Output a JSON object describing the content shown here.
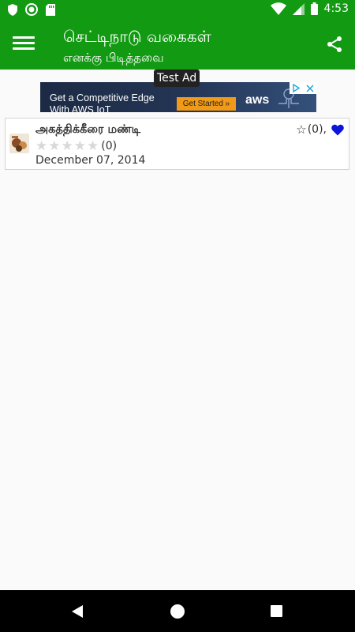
{
  "status_bar": {
    "time": "4:53",
    "icons": [
      "shield-icon",
      "circle-icon",
      "sd-card-icon",
      "wifi-icon",
      "signal-icon",
      "battery-icon"
    ]
  },
  "app_bar": {
    "title": "செட்டிநாடு வகைகள்",
    "subtitle": "எனக்கு பிடித்தவை",
    "menu_icon": "hamburger-menu-icon",
    "share_icon": "share-icon"
  },
  "ad": {
    "label": "Test Ad",
    "headline": "Get a Competitive Edge",
    "subline": "With AWS IoT",
    "cta": "Get Started »",
    "brand": "aws"
  },
  "recipes": [
    {
      "title": "அகத்திக்கீரை மண்டி",
      "rating_count": "(0)",
      "date": "December 07, 2014",
      "favorite_count": "(0),",
      "rating_value": 0
    }
  ],
  "colors": {
    "primary": "#129a12",
    "heart": "#0b16d8",
    "star_empty": "#d8d8d8"
  },
  "nav_bar": {
    "icons": [
      "back-icon",
      "home-icon",
      "recent-apps-icon"
    ]
  }
}
